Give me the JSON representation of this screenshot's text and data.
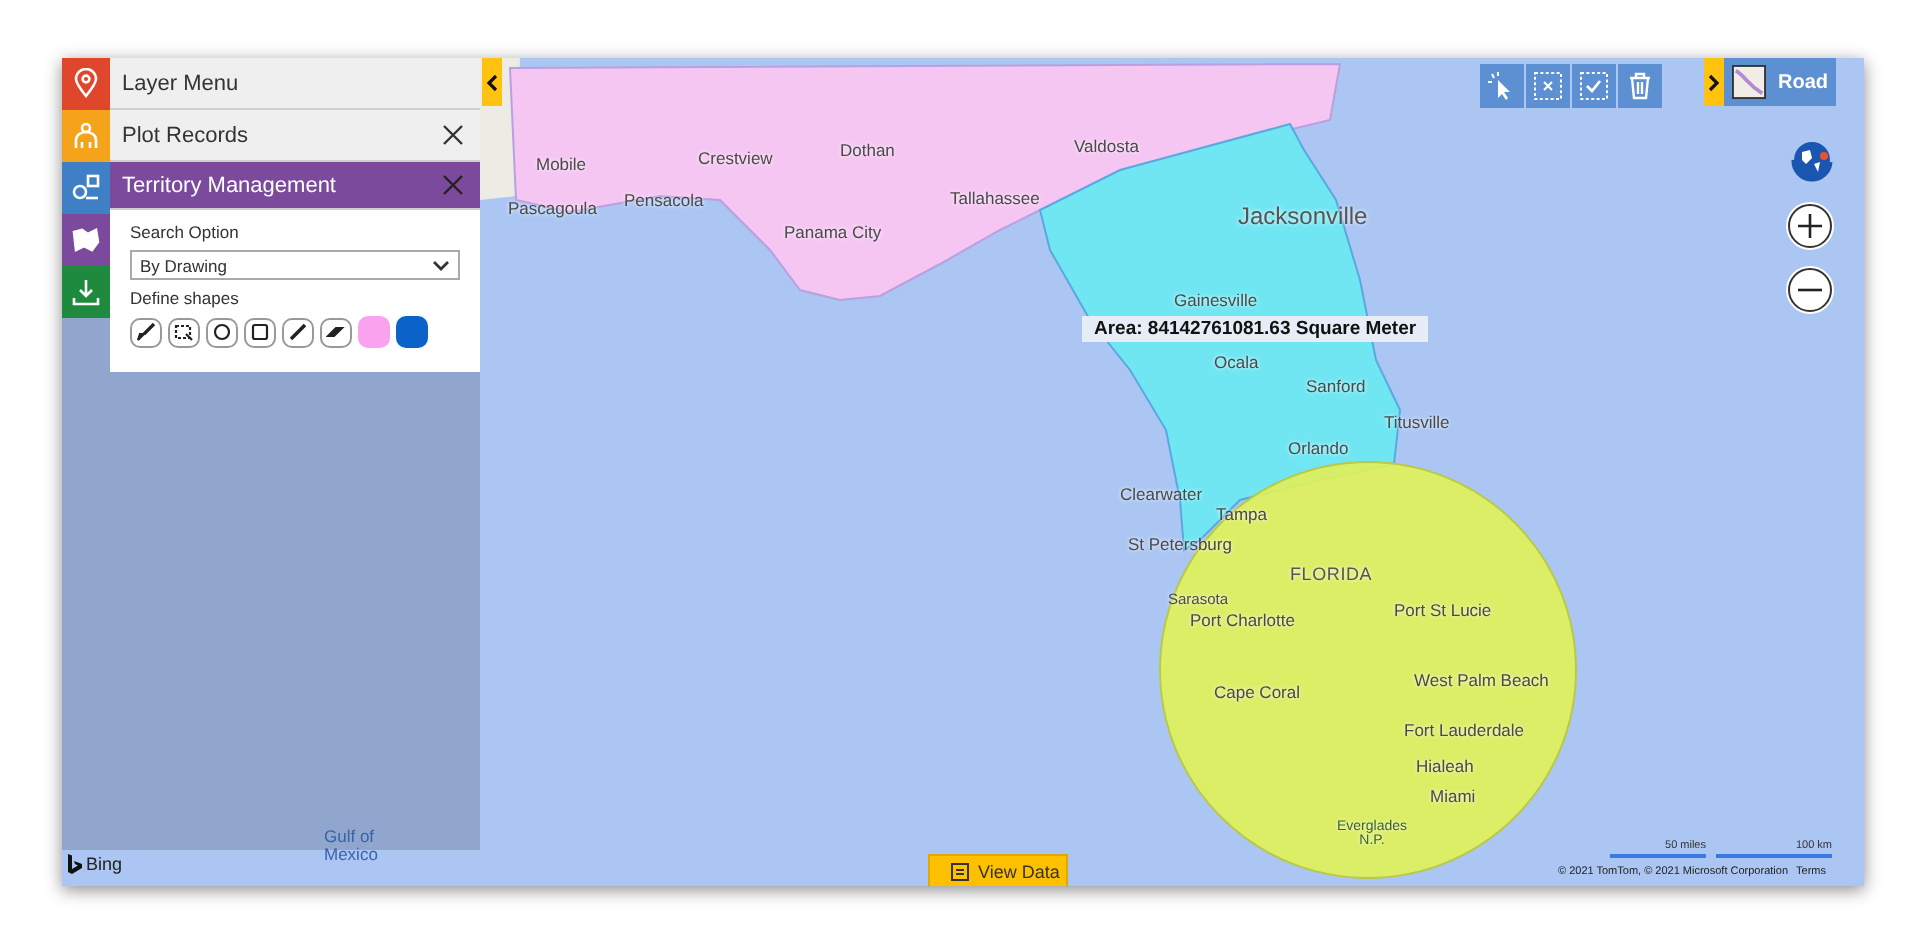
{
  "side_rail": [
    {
      "kind": "pin",
      "color": "#e0462b"
    },
    {
      "kind": "people",
      "color": "#f5a31a"
    },
    {
      "kind": "route",
      "color": "#3f7fc6"
    },
    {
      "kind": "territory",
      "color": "#7b4a9c"
    },
    {
      "kind": "download",
      "color": "#1e8a3e"
    }
  ],
  "layer_menu": {
    "title": "Layer Menu"
  },
  "plot_records": {
    "title": "Plot Records"
  },
  "territory_management": {
    "title": "Territory Management",
    "search_label": "Search Option",
    "search_value": "By Drawing",
    "shapes_label": "Define shapes",
    "tools": [
      {
        "kind": "brush"
      },
      {
        "kind": "select"
      },
      {
        "kind": "circle"
      },
      {
        "kind": "square"
      },
      {
        "kind": "pencil"
      },
      {
        "kind": "eraser"
      },
      {
        "kind": "swatch",
        "color": "#f9a3ef"
      },
      {
        "kind": "swatch",
        "color": "#0b63c9"
      }
    ]
  },
  "map": {
    "labels": [
      {
        "text": "Dothan",
        "kind": "city"
      },
      {
        "text": "Mobile",
        "kind": "city"
      },
      {
        "text": "Crestview",
        "kind": "city"
      },
      {
        "text": "Valdosta",
        "kind": "city"
      },
      {
        "text": "Pascagoula",
        "kind": "city"
      },
      {
        "text": "Pensacola",
        "kind": "city"
      },
      {
        "text": "Tallahassee",
        "kind": "city"
      },
      {
        "text": "Panama City",
        "kind": "city"
      },
      {
        "text": "Jacksonville",
        "kind": "major"
      },
      {
        "text": "Gainesville",
        "kind": "city"
      },
      {
        "text": "Ocala",
        "kind": "city"
      },
      {
        "text": "Sanford",
        "kind": "city"
      },
      {
        "text": "Titusville",
        "kind": "city"
      },
      {
        "text": "Orlando",
        "kind": "city"
      },
      {
        "text": "Clearwater",
        "kind": "city"
      },
      {
        "text": "Tampa",
        "kind": "city"
      },
      {
        "text": "St Petersburg",
        "kind": "city"
      },
      {
        "text": "FLORIDA",
        "kind": "region"
      },
      {
        "text": "Sarasota",
        "kind": "small"
      },
      {
        "text": "Port Charlotte",
        "kind": "city"
      },
      {
        "text": "Port St Lucie",
        "kind": "city"
      },
      {
        "text": "Cape Coral",
        "kind": "city"
      },
      {
        "text": "West Palm Beach",
        "kind": "city"
      },
      {
        "text": "Fort Lauderdale",
        "kind": "city"
      },
      {
        "text": "Hialeah",
        "kind": "city"
      },
      {
        "text": "Miami",
        "kind": "city"
      },
      {
        "text": "Everglades N.P.",
        "kind": "park"
      },
      {
        "text": "Gulf of Mexico",
        "kind": "water"
      }
    ],
    "area_tooltip": "Area: 84142761081.63 Square Meter"
  },
  "basemap": {
    "label": "Road"
  },
  "view_data": {
    "label": "View Data"
  },
  "attribution": {
    "logo": "Bing",
    "copyright": "© 2021 TomTom, © 2021 Microsoft Corporation",
    "terms": "Terms"
  },
  "scale": [
    {
      "label": "50 miles"
    },
    {
      "label": "100 km"
    }
  ]
}
